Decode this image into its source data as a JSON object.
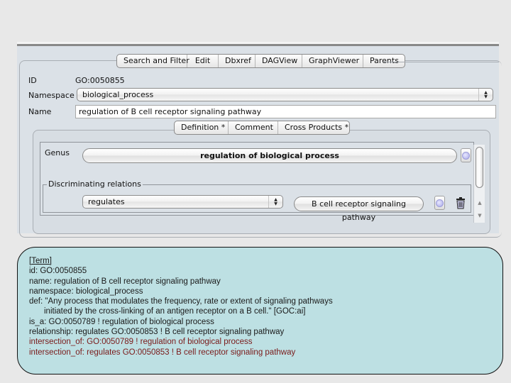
{
  "main_tabs": [
    "Search and Filter",
    "Edit",
    "Dbxref",
    "DAGView",
    "GraphViewer",
    "Parents"
  ],
  "fields": {
    "id_label": "ID",
    "id_value": "GO:0050855",
    "namespace_label": "Namespace",
    "namespace_value": "biological_process",
    "name_label": "Name",
    "name_value": "regulation of B cell receptor signaling pathway"
  },
  "definition_tabs": [
    "Definition *",
    "Comment",
    "Cross Products *"
  ],
  "cross_products": {
    "genus_label": "Genus",
    "genus_value": "regulation of biological process",
    "discriminating_title": "Discriminating relations",
    "relation_value": "regulates",
    "target_value": "B cell receptor signaling pathway",
    "icons": {
      "genus_browse": "term-browse-icon",
      "target_browse": "term-browse-icon",
      "delete": "trash-icon"
    }
  },
  "obo_text": {
    "lines": [
      {
        "text": "[Term]",
        "style": "header"
      },
      {
        "text": "id: GO:0050855",
        "style": "normal"
      },
      {
        "text": "name: regulation of B cell receptor signaling pathway",
        "style": "normal"
      },
      {
        "text": "namespace: biological_process",
        "style": "normal"
      },
      {
        "text": "def: \"Any process that modulates the frequency, rate or extent of signaling pathways",
        "style": "normal"
      },
      {
        "text": "initiated by the cross-linking of an antigen receptor on a B cell.\" [GOC:ai]",
        "style": "indent"
      },
      {
        "text": "is_a: GO:0050789 ! regulation of biological process",
        "style": "normal"
      },
      {
        "text": "relationship: regulates GO:0050853 ! B cell receptor signaling pathway",
        "style": "normal"
      },
      {
        "text": "intersection_of: GO:0050789 ! regulation of biological process",
        "style": "red"
      },
      {
        "text": "intersection_of: regulates GO:0050853 ! B cell receptor signaling pathway",
        "style": "red"
      }
    ]
  },
  "colors": {
    "panel_bg": "#dbe1e7",
    "obo_bg": "#bde0e3",
    "intersection_text": "#7a1a1a"
  }
}
